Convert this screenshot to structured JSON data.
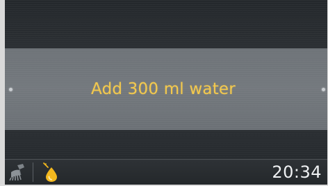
{
  "message": {
    "text": "Add 300 ml water",
    "color": "#f3c94e"
  },
  "navigation": {
    "left_indicator": "nav-dot",
    "right_indicator": "nav-dot"
  },
  "status_bar": {
    "icons": [
      "brush-cleaning-icon",
      "oil-drop-icon"
    ],
    "oil_icon_color": "#f3b81e",
    "clock": "20:34"
  }
}
